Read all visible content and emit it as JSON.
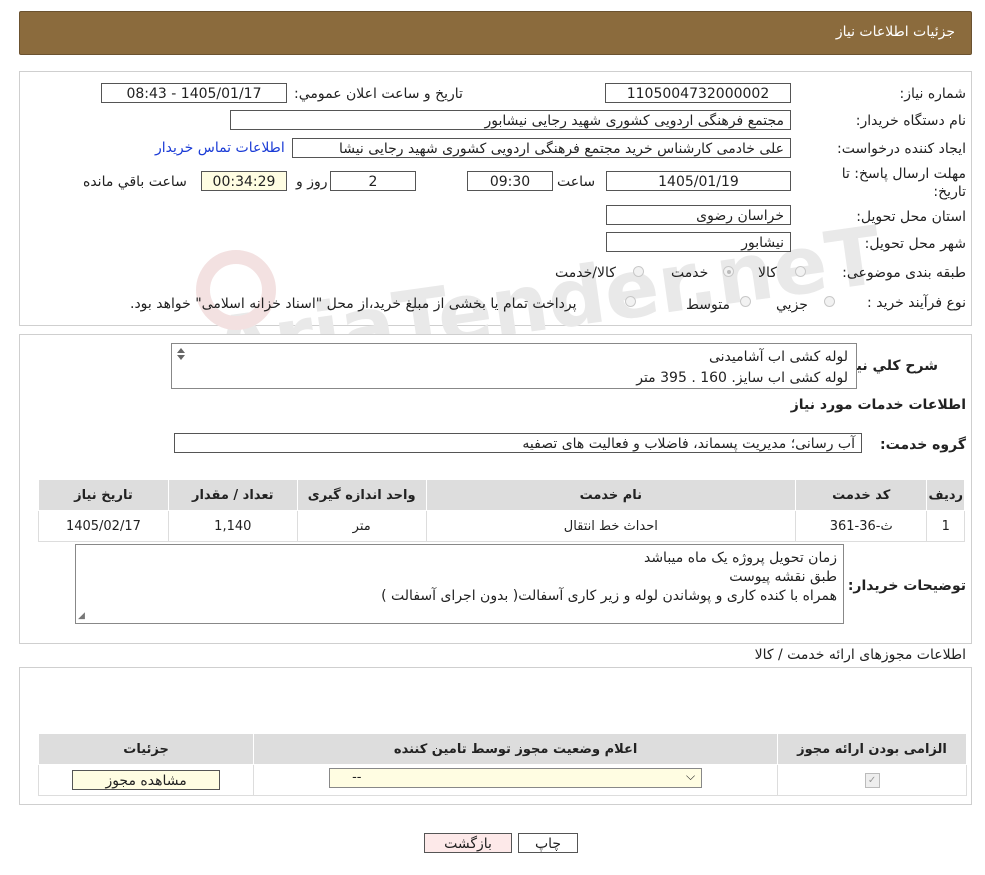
{
  "header": {
    "title": "جزئیات اطلاعات نیاز"
  },
  "watermark": {
    "text": "AriaTender.neT"
  },
  "details": {
    "need_number_label": "شماره نیاز:",
    "need_number": "1105004732000002",
    "announce_label": "تاریخ و ساعت اعلان عمومي:",
    "announce_value": "1405/01/17 - 08:43",
    "buyer_org_label": "نام دستگاه خريدار:",
    "buyer_org": "مجتمع فرهنگی اردویی کشوری شهید رجایی نیشابور",
    "creator_label": "ايجاد كننده درخواست:",
    "creator": "علی خادمی کارشناس خرید مجتمع فرهنگی اردویی کشوری شهید رجایی نیشا",
    "contact_link": "اطلاعات تماس خريدار",
    "deadline_label": "مهلت ارسال پاسخ: تا تاريخ:",
    "deadline_date": "1405/01/19",
    "time_label": "ساعت",
    "deadline_time": "09:30",
    "days_value": "2",
    "days_label": "روز و",
    "remaining_time": "00:34:29",
    "remaining_label": "ساعت باقي مانده",
    "province_label": "استان محل تحويل:",
    "province": "خراسان رضوی",
    "city_label": "شهر محل تحويل:",
    "city": "نیشابور",
    "category_label": "طبقه بندی موضوعی:",
    "category_options": [
      "كالا",
      "خدمت",
      "كالا/خدمت"
    ],
    "category_selected": "خدمت",
    "process_label": "نوع فرآيند خريد :",
    "process_options": [
      "جزيي",
      "متوسط"
    ],
    "process_note": "پرداخت تمام یا بخشی از مبلغ خرید،از محل \"اسناد خزانه اسلامی\" خواهد بود."
  },
  "summary": {
    "label": "شرح كلي نياز:",
    "lines": [
      "لوله کشی اب آشامیدنی",
      "لوله کشی اب سایز. 160 . 395 متر"
    ]
  },
  "services": {
    "section_title": "اطلاعات خدمات مورد نياز",
    "group_label": "گروه خدمت:",
    "group_value": "آب رسانی؛ مدیریت پسماند، فاضلاب و فعالیت های تصفیه",
    "columns": [
      "رديف",
      "كد خدمت",
      "نام خدمت",
      "واحد اندازه گيری",
      "تعداد / مقدار",
      "تاريخ نياز"
    ],
    "rows": [
      {
        "index": "1",
        "code": "ث-36-361",
        "name": "احداث خط انتقال",
        "unit": "متر",
        "qty": "1,140",
        "date": "1405/02/17"
      }
    ]
  },
  "buyer_notes": {
    "label": "توضيحات خريدار:",
    "lines": [
      "زمان تحویل پروژه یک ماه میباشد",
      "طبق نقشه پیوست",
      "همراه با کنده کاری و پوشاندن لوله و زیر کاری آسفالت( بدون اجرای آسفالت )"
    ]
  },
  "permits": {
    "title": "اطلاعات مجوزهای ارائه خدمت / كالا",
    "columns": [
      "الزامی بودن ارائه مجوز",
      "اعلام وضعيت مجوز توسط تامين كننده",
      "جزئيات"
    ],
    "select_value": "--",
    "view_button": "مشاهده مجوز"
  },
  "buttons": {
    "print": "چاپ",
    "back": "بازگشت"
  }
}
